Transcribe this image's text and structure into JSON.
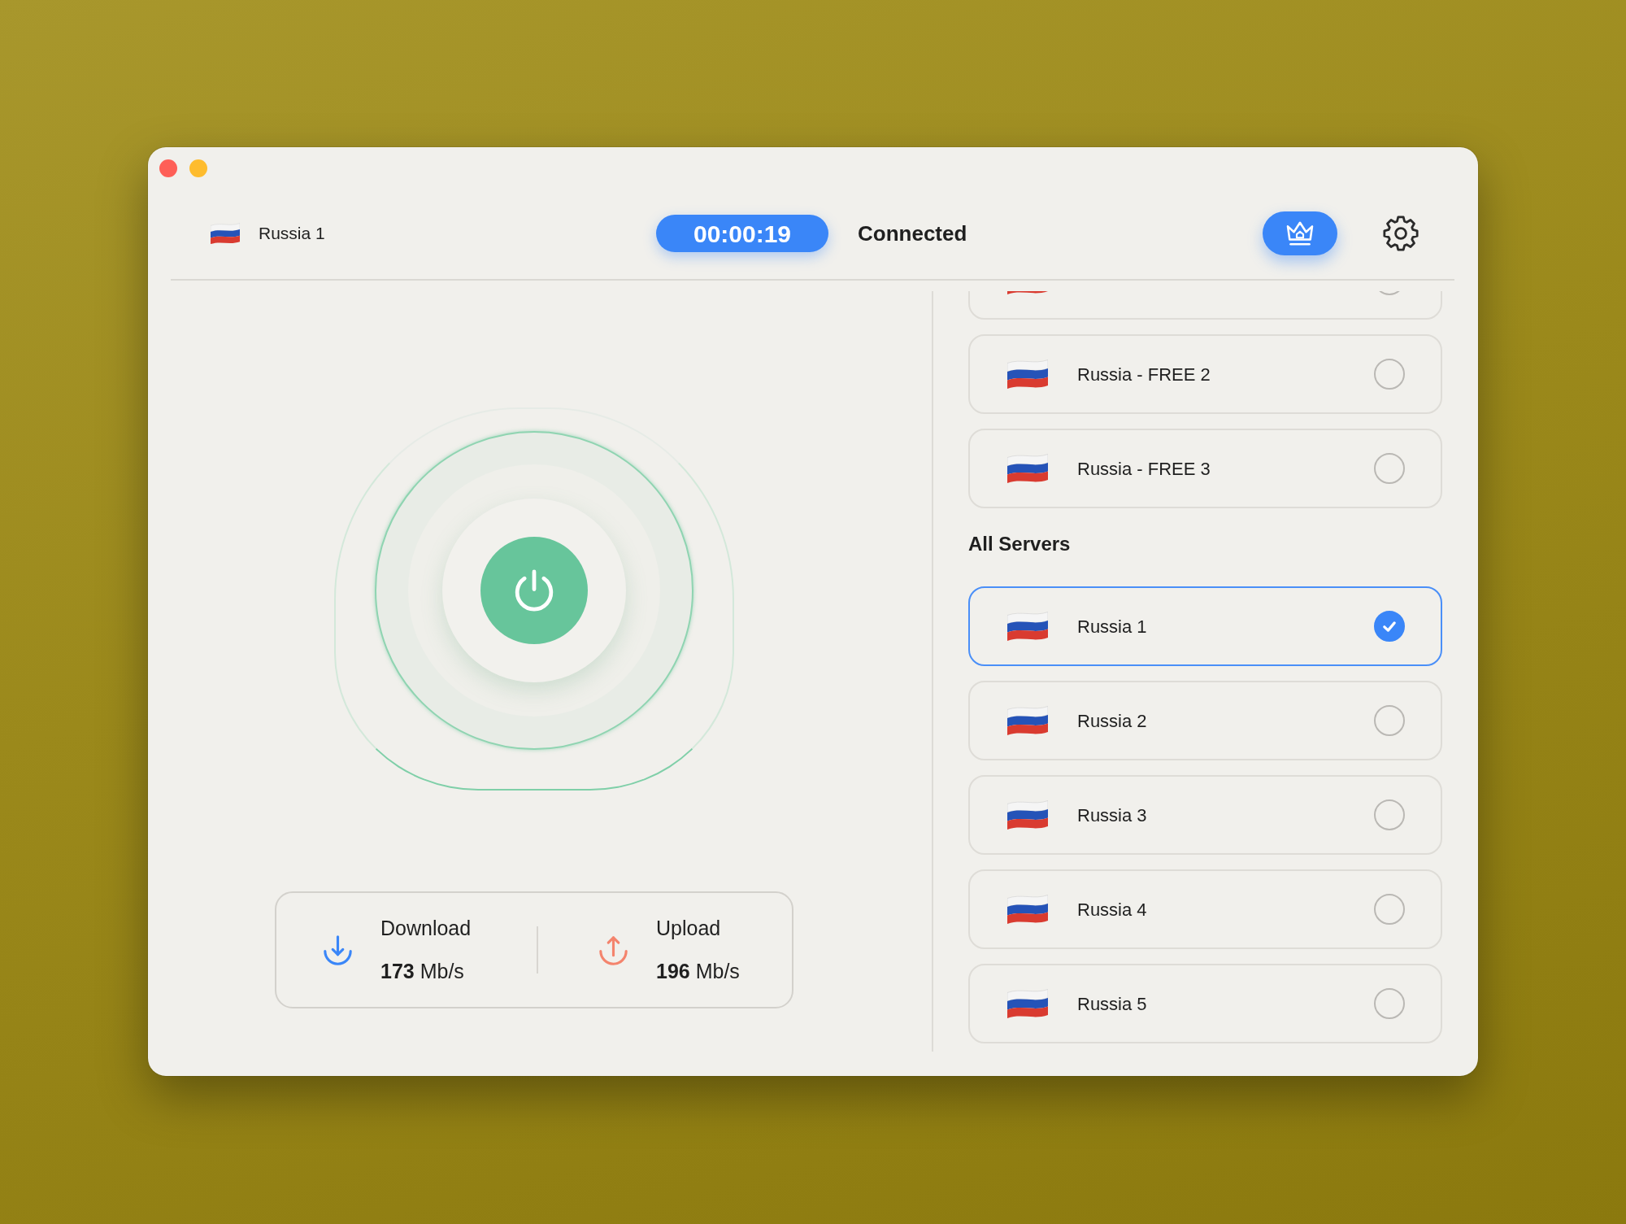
{
  "window": {
    "controls": [
      {
        "kind": "close"
      },
      {
        "kind": "minimize"
      }
    ]
  },
  "header": {
    "server": "Russia 1",
    "timer": "00:00:19",
    "status": "Connected"
  },
  "power": {
    "on": true
  },
  "speeds": [
    {
      "kind": "download",
      "label": "Download",
      "reading": "**173** Mb/s"
    },
    {
      "kind": "upload",
      "label": "Upload",
      "reading": "**196** Mb/s"
    }
  ],
  "server_list": {
    "sections": [
      {
        "items": [
          {
            "selected": false
          },
          {
            "name": "Russia - FREE 2",
            "selected": false
          },
          {
            "name": "Russia - FREE 3",
            "selected": false
          }
        ]
      },
      {
        "heading": "All Servers",
        "items": [
          {
            "name": "Russia 1",
            "selected": true
          },
          {
            "name": "Russia 2",
            "selected": false
          },
          {
            "name": "Russia 3",
            "selected": false
          },
          {
            "name": "Russia 4",
            "selected": false
          },
          {
            "name": "Russia 5",
            "selected": false
          }
        ]
      }
    ]
  }
}
